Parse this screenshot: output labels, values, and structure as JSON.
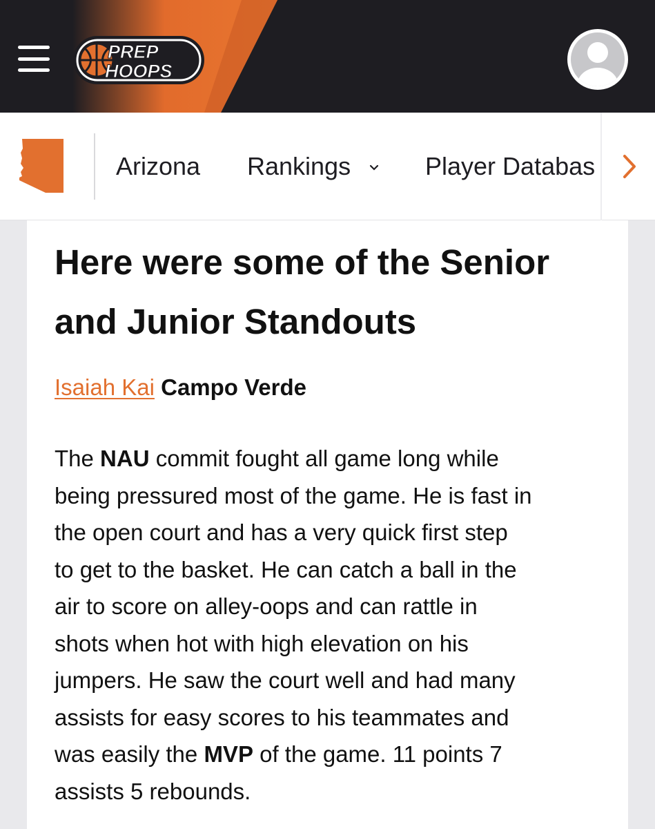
{
  "header": {
    "logo_line1": "PREP",
    "logo_line2": "HOOPS",
    "menu_icon": "hamburger-icon",
    "avatar_icon": "user-avatar-icon",
    "colors": {
      "background": "#1e1d22",
      "accent": "#e2702f"
    }
  },
  "subnav": {
    "state_icon": "arizona-state-icon",
    "items": [
      {
        "label": "Arizona"
      },
      {
        "label": "Rankings",
        "icon": "chevron-down-icon"
      },
      {
        "label": "Player Databas"
      }
    ],
    "scroll_icon": "chevron-right-icon"
  },
  "article": {
    "headline": "Here were some of the Senior and Junior Standouts",
    "player_name": "Isaiah Kai",
    "school": "Campo Verde",
    "paragraph_lines": [
      [
        "The ",
        "NAU",
        " commit fought all game long while"
      ],
      [
        "being pressured most of the game. He is fast in"
      ],
      [
        "the open court and has a very quick first step"
      ],
      [
        "to get to the basket. He can catch a ball in the"
      ],
      [
        "air to score on alley-oops and can rattle in"
      ],
      [
        "shots when hot with high elevation on his"
      ],
      [
        "jumpers. He saw the court well and had many"
      ],
      [
        "assists for easy scores to his teammates and"
      ],
      [
        "was easily the ",
        "MVP",
        " of the game. 11 points 7"
      ],
      [
        "assists 5 rebounds."
      ]
    ]
  }
}
